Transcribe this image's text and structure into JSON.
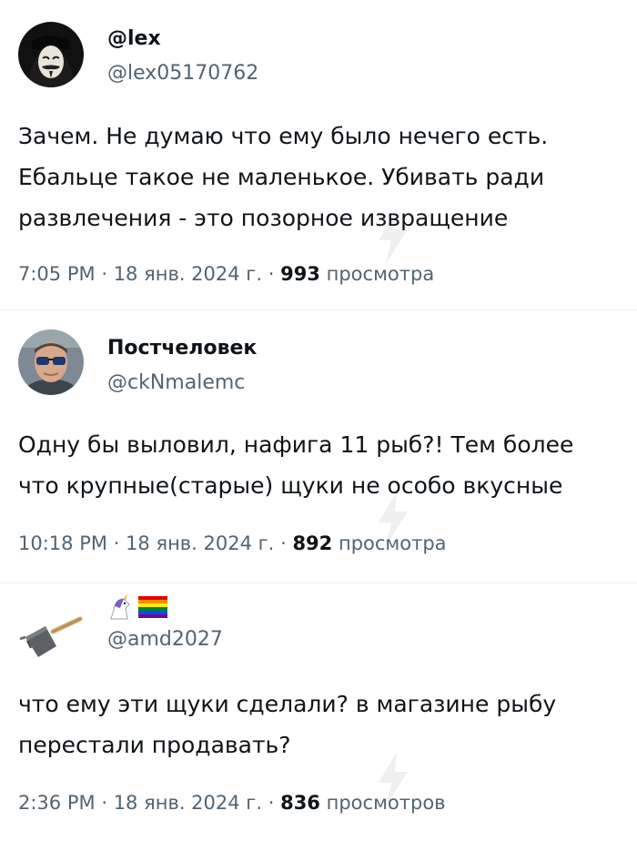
{
  "tweets": [
    {
      "display_name": "@lex",
      "handle": "@lex05170762",
      "avatar": "mask-avatar",
      "text_lines": [
        "Зачем. Не думаю что ему было нечего есть.",
        "Ебальце такое не маленькое. Убивать ради",
        "развлечения - это позорное извращение"
      ],
      "time": "7:05 PM",
      "date": "18 янв. 2024 г.",
      "views": "993",
      "views_label": "просмотра"
    },
    {
      "display_name": "Постчеловек",
      "handle": "@ckNmalemc",
      "avatar": "man-sunglasses-avatar",
      "text_lines": [
        "Одну бы выловил, нафига 11 рыб?! Тем более",
        "что крупные(старые) щуки не особо вкусные"
      ],
      "time": "10:18 PM",
      "date": "18 янв. 2024 г.",
      "views": "892",
      "views_label": "просмотра"
    },
    {
      "display_name_emoji": [
        "unicorn-emoji",
        "rainbow-flag-emoji"
      ],
      "handle": "@amd2027",
      "avatar": "hammer-avatar",
      "text_lines": [
        "что ему эти щуки сделали? в магазине рыбу",
        "перестали продавать?"
      ],
      "time": "2:36 PM",
      "date": "18 янв. 2024 г.",
      "views": "836",
      "views_label": "просмотров"
    }
  ],
  "separator": "·",
  "colors": {
    "text": "#0f1419",
    "secondary": "#536471",
    "divider": "#eff3f4"
  }
}
